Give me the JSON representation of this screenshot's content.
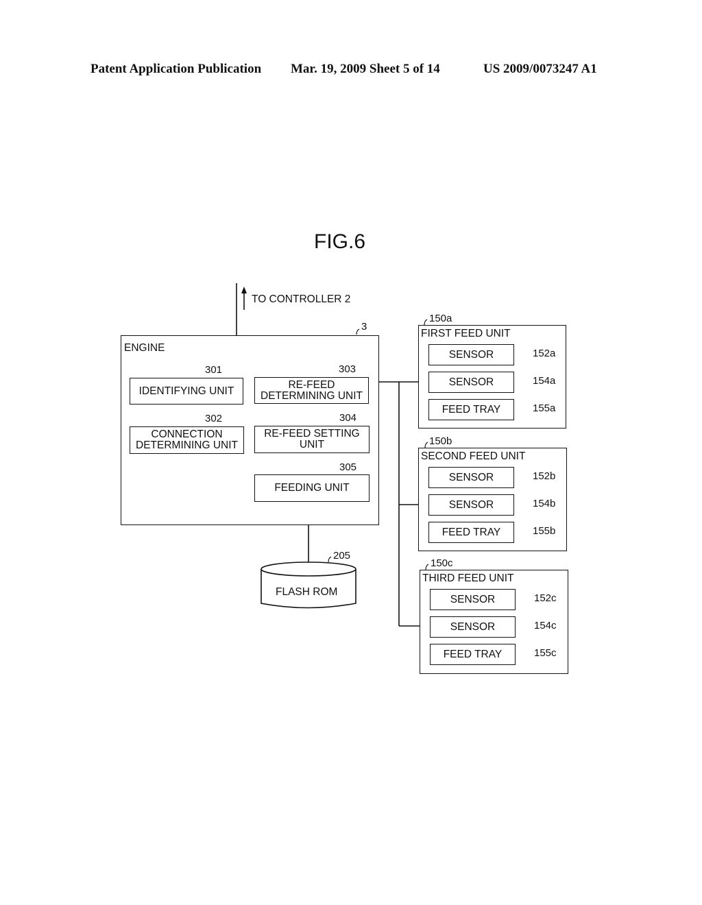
{
  "header": {
    "publication": "Patent Application Publication",
    "date_sheet": "Mar. 19, 2009  Sheet 5 of 14",
    "patent_number": "US 2009/0073247 A1"
  },
  "figure": {
    "title": "FIG.6",
    "to_controller": "TO CONTROLLER 2",
    "engine": {
      "label": "ENGINE",
      "ref": "3",
      "units": [
        {
          "name": "IDENTIFYING UNIT",
          "ref": "301"
        },
        {
          "name": "CONNECTION DETERMINING UNIT",
          "line1": "CONNECTION",
          "line2": "DETERMINING UNIT",
          "ref": "302"
        },
        {
          "name": "RE-FEED DETERMINING UNIT",
          "line1": "RE-FEED",
          "line2": "DETERMINING UNIT",
          "ref": "303"
        },
        {
          "name": "RE-FEED SETTING UNIT",
          "line1": "RE-FEED SETTING",
          "line2": "UNIT",
          "ref": "304"
        },
        {
          "name": "FEEDING UNIT",
          "ref": "305"
        }
      ]
    },
    "flash_rom": {
      "label": "FLASH ROM",
      "ref": "205"
    },
    "feed_units": [
      {
        "label": "FIRST FEED UNIT",
        "ref": "150a",
        "items": [
          {
            "label": "SENSOR",
            "ref": "152a"
          },
          {
            "label": "SENSOR",
            "ref": "154a"
          },
          {
            "label": "FEED TRAY",
            "ref": "155a"
          }
        ]
      },
      {
        "label": "SECOND FEED UNIT",
        "ref": "150b",
        "items": [
          {
            "label": "SENSOR",
            "ref": "152b"
          },
          {
            "label": "SENSOR",
            "ref": "154b"
          },
          {
            "label": "FEED TRAY",
            "ref": "155b"
          }
        ]
      },
      {
        "label": "THIRD FEED UNIT",
        "ref": "150c",
        "items": [
          {
            "label": "SENSOR",
            "ref": "152c"
          },
          {
            "label": "SENSOR",
            "ref": "154c"
          },
          {
            "label": "FEED TRAY",
            "ref": "155c"
          }
        ]
      }
    ]
  }
}
